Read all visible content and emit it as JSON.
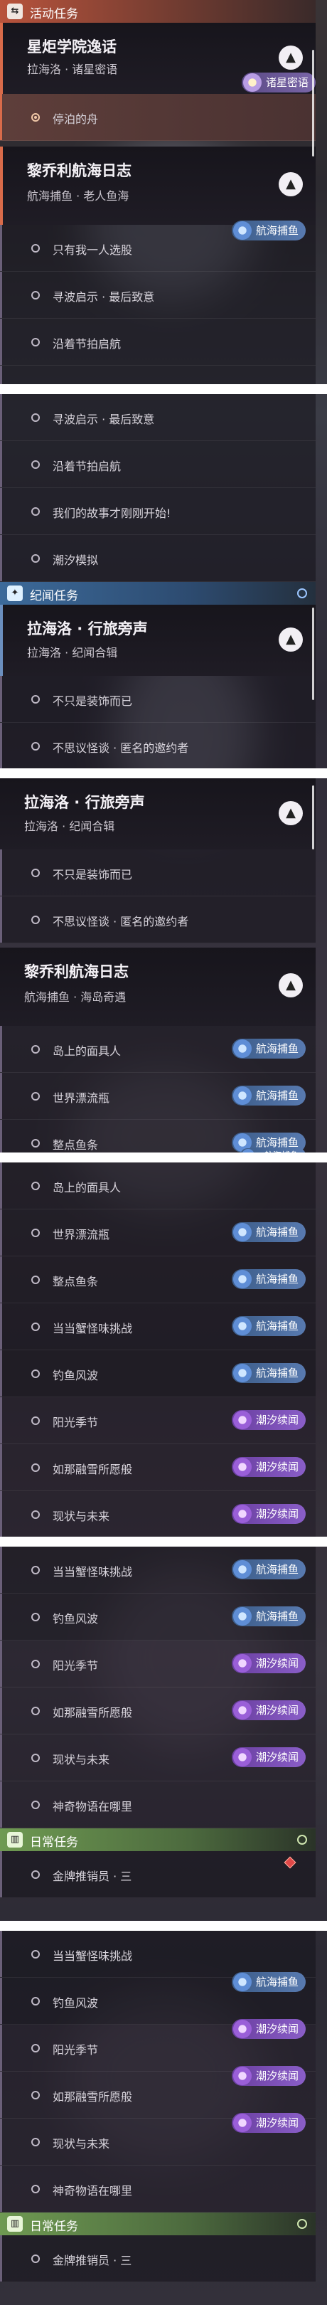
{
  "sections": {
    "activity": "活动任务",
    "story": "纪闻任务",
    "daily": "日常任务"
  },
  "cards": {
    "torch": {
      "title": "星炬学院逸话",
      "sub": "拉海洛 · 诸星密语"
    },
    "lahailuo": {
      "title": "拉海洛 · 行旅旁声",
      "sub": "拉海洛 · 纪闻合辑"
    },
    "liqiao_old": {
      "title": "黎乔利航海日志",
      "sub": "航海捕鱼 · 老人鱼海"
    },
    "liqiao_sea": {
      "title": "黎乔利航海日志",
      "sub": "航海捕鱼 · 海岛奇遇"
    }
  },
  "tags": {
    "sea": "航海捕鱼",
    "tide": "潮汐续闻",
    "star": "诸星密语"
  },
  "quests": {
    "moored_boat": "停泊的舟",
    "only_me": "只有我一人选股",
    "rumor": "寻波启示 · 最后致意",
    "along_festival": "沿着节拍启航",
    "our_story": "我们的故事才刚刚开始!",
    "tide_sim": "潮汐模拟",
    "not_decoration": "不只是装饰而已",
    "incredible_letter": "不思议怪谈 · 匿名的邀约者",
    "island_man": "岛上的面具人",
    "world_bottle": "世界漂流瓶",
    "whole_fish": "整点鱼条",
    "crab_challenge": "当当蟹怪味挑战",
    "fishing_storm": "钓鱼风波",
    "sunshine_season": "阳光季节",
    "melting_snow": "如那融雪所愿般",
    "now_future": "现状与未来",
    "artifact_where": "神奇物语在哪里",
    "gold_sales": "金牌推销员 · 三"
  },
  "colors": {
    "activity": "#b8533c",
    "story": "#3c6a9a",
    "daily": "#6f9a52",
    "accent": "#d96b4a"
  }
}
